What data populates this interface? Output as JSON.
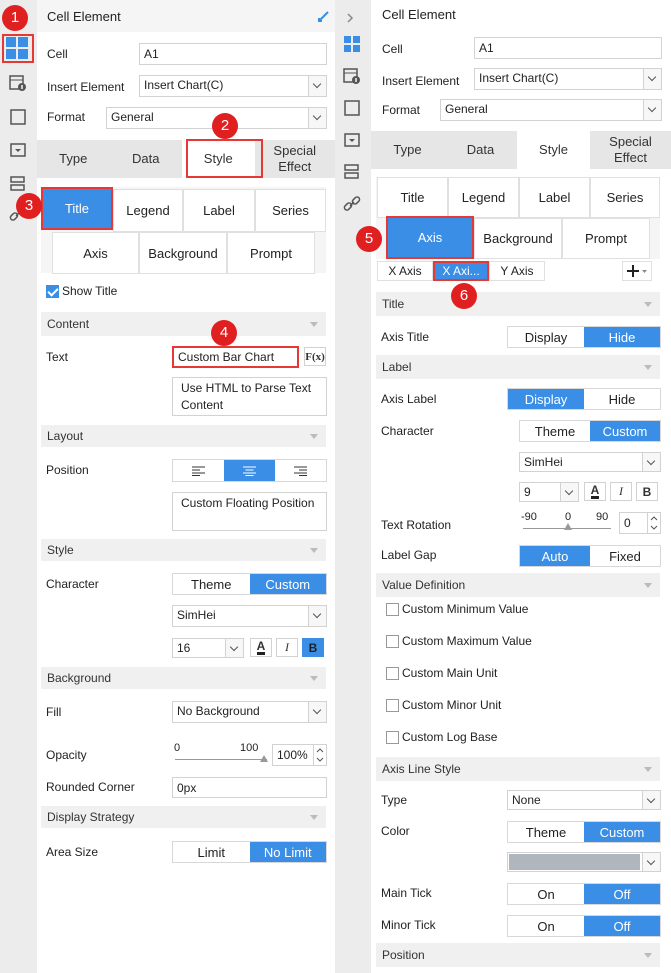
{
  "left": {
    "title": "Cell Element",
    "cell_label": "Cell",
    "cell_value": "A1",
    "insert_label": "Insert Element",
    "insert_value": "Insert Chart(C)",
    "format_label": "Format",
    "format_value": "General",
    "tabs": [
      "Type",
      "Data",
      "Style",
      "Special Effect"
    ],
    "subtabs": [
      "Title",
      "Legend",
      "Label",
      "Series",
      "Axis",
      "Background",
      "Prompt"
    ],
    "show_title": "Show Title",
    "content_section": "Content",
    "text_label": "Text",
    "text_value": "Custom Bar Chart",
    "fx": "F(x)",
    "html_parse": "Use HTML to Parse Text Content",
    "layout_section": "Layout",
    "position_label": "Position",
    "custom_floating": "Custom Floating Position",
    "style_section": "Style",
    "character_label": "Character",
    "theme": "Theme",
    "custom": "Custom",
    "font": "SimHei",
    "font_size": "16",
    "italic": "I",
    "bold": "B",
    "underline_a": "A",
    "background_section": "Background",
    "fill_label": "Fill",
    "fill_value": "No Background",
    "opacity_label": "Opacity",
    "opacity_min": "0",
    "opacity_max": "100",
    "opacity_value": "100%",
    "opacity_fraction": 1.0,
    "rounded_label": "Rounded Corner",
    "rounded_value": "0px",
    "display_section": "Display Strategy",
    "area_label": "Area Size",
    "limit": "Limit",
    "no_limit": "No Limit"
  },
  "right": {
    "title": "Cell Element",
    "cell_label": "Cell",
    "cell_value": "A1",
    "insert_label": "Insert Element",
    "insert_value": "Insert Chart(C)",
    "format_label": "Format",
    "format_value": "General",
    "tabs": [
      "Type",
      "Data",
      "Style",
      "Special Effect"
    ],
    "subtabs": [
      "Title",
      "Legend",
      "Label",
      "Series",
      "Axis",
      "Background",
      "Prompt"
    ],
    "axis_tabs": [
      "X Axis",
      "X Axi...",
      "Y Axis"
    ],
    "title_section": "Title",
    "axis_title_label": "Axis Title",
    "display": "Display",
    "hide": "Hide",
    "label_section": "Label",
    "axis_label_label": "Axis Label",
    "character_label": "Character",
    "theme": "Theme",
    "custom": "Custom",
    "font": "SimHei",
    "font_size": "9",
    "italic": "I",
    "bold": "B",
    "underline_a": "A",
    "rotation_label": "Text Rotation",
    "rot_min": "-90",
    "rot_mid": "0",
    "rot_max": "90",
    "rot_value": "0",
    "label_gap_label": "Label Gap",
    "auto": "Auto",
    "fixed": "Fixed",
    "value_section": "Value Definition",
    "checks": [
      "Custom Minimum Value",
      "Custom Maximum Value",
      "Custom Main Unit",
      "Custom Minor Unit",
      "Custom Log Base"
    ],
    "axis_line_section": "Axis Line Style",
    "type_label": "Type",
    "type_value": "None",
    "color_label": "Color",
    "color_swatch": "#b0b6bd",
    "main_tick_label": "Main Tick",
    "minor_tick_label": "Minor Tick",
    "on": "On",
    "off": "Off",
    "position_section": "Position"
  },
  "badges": [
    "1",
    "2",
    "3",
    "4",
    "5",
    "6"
  ],
  "accent": "#3a8ee6",
  "highlight": "#e53935"
}
